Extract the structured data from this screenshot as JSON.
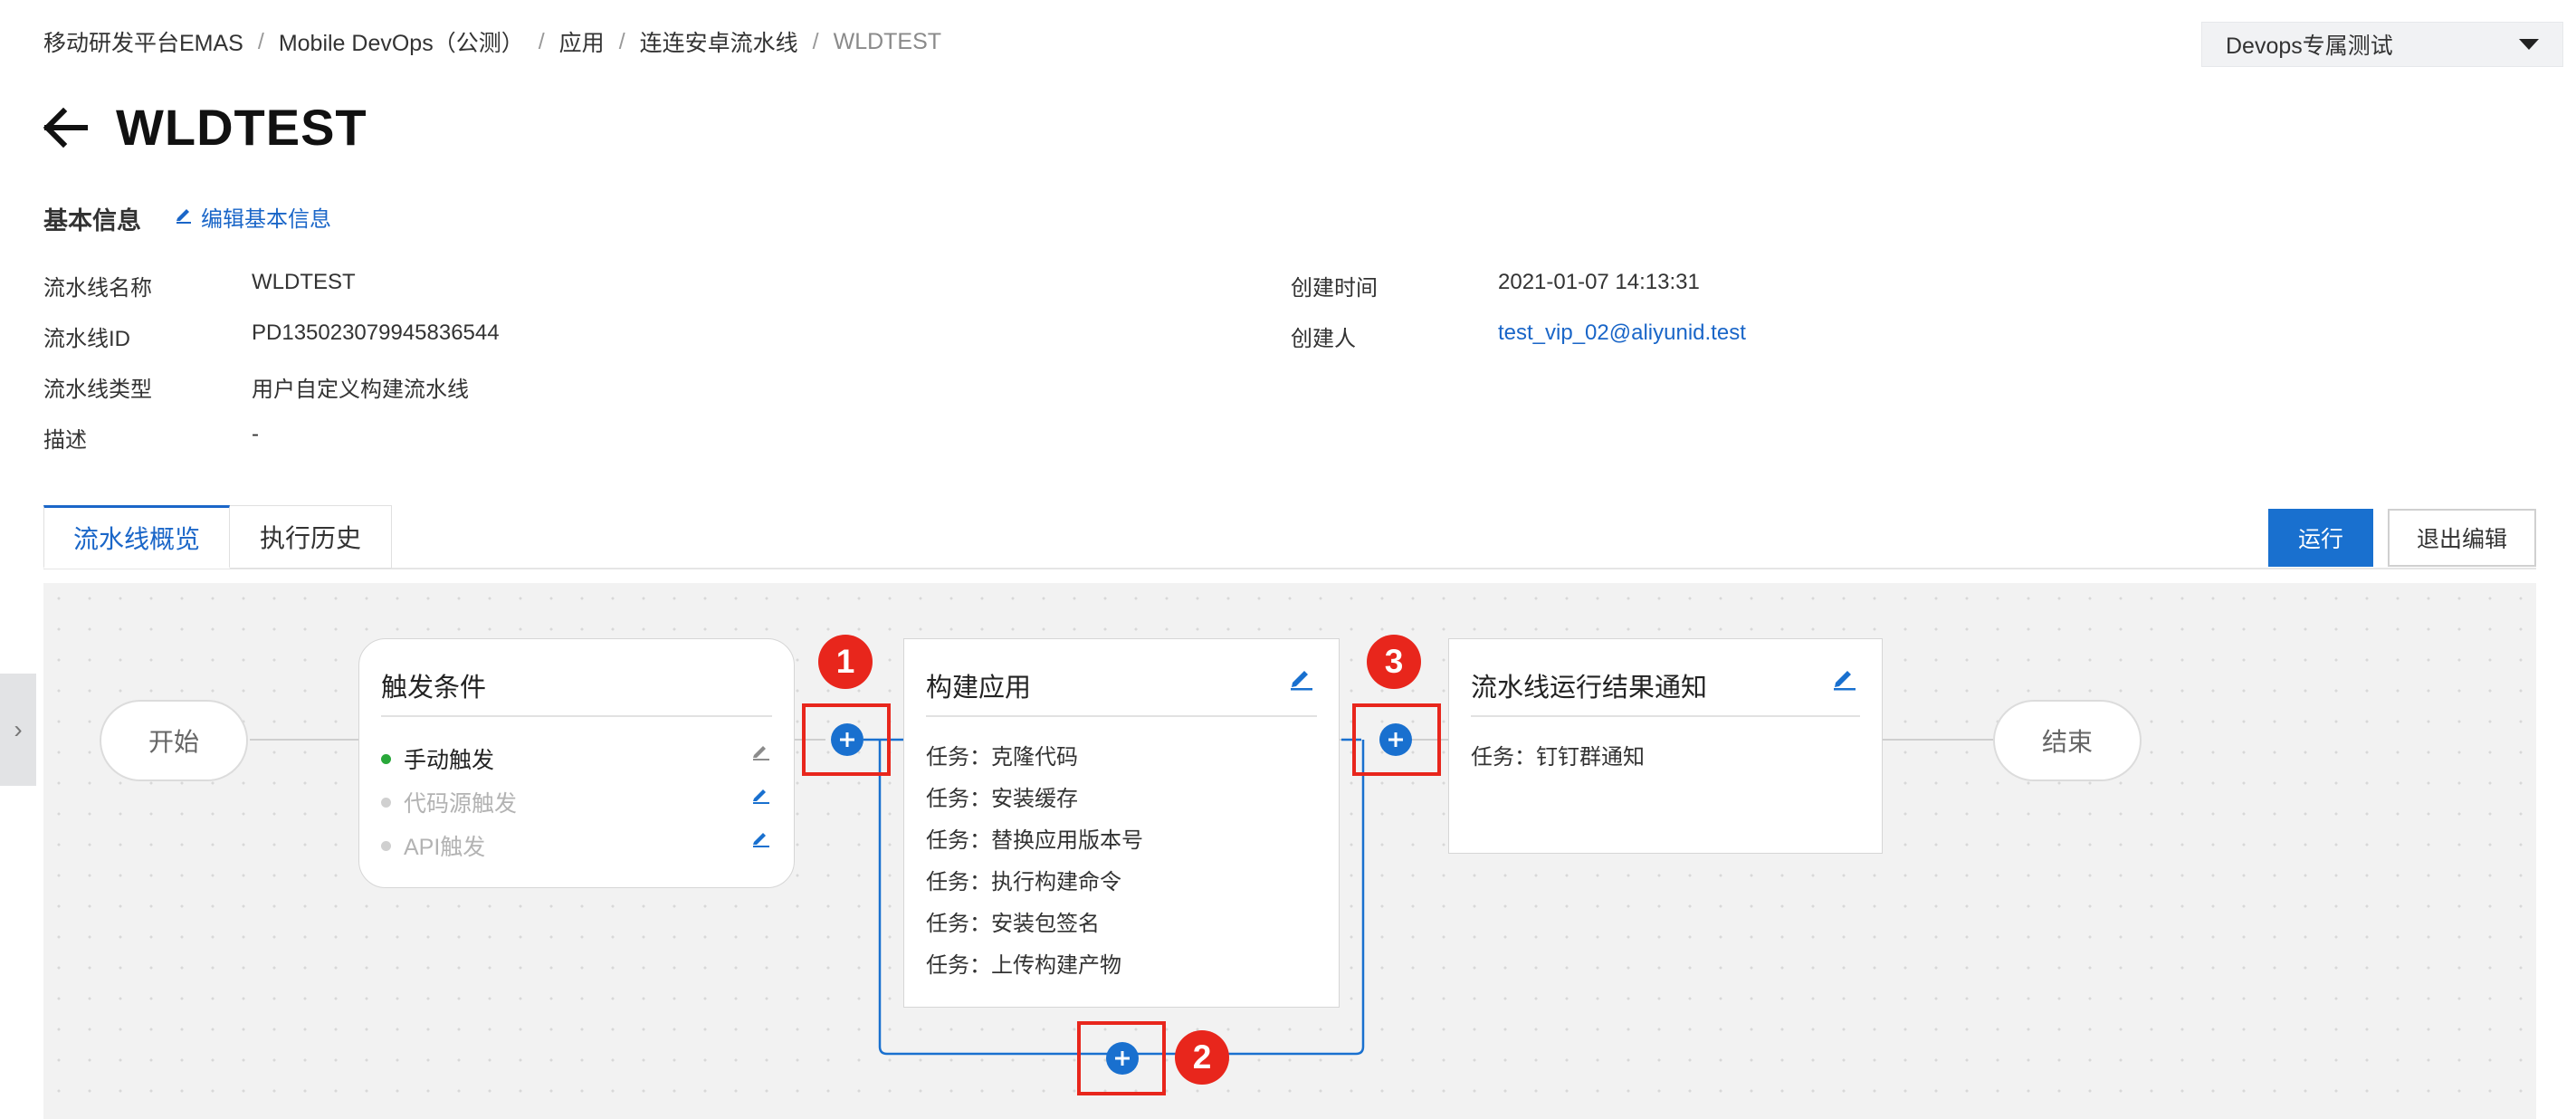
{
  "breadcrumb": [
    "移动研发平台EMAS",
    "Mobile DevOps（公测）",
    "应用",
    "连连安卓流水线",
    "WLDTEST"
  ],
  "project_selector": {
    "value": "Devops专属测试"
  },
  "page_title": "WLDTEST",
  "basic_info": {
    "section_title": "基本信息",
    "edit_label": "编辑基本信息",
    "fields": {
      "name_label": "流水线名称",
      "name_value": "WLDTEST",
      "id_label": "流水线ID",
      "id_value": "PD135023079945836544",
      "type_label": "流水线类型",
      "type_value": "用户自定义构建流水线",
      "desc_label": "描述",
      "desc_value": "-",
      "created_time_label": "创建时间",
      "created_time_value": "2021-01-07 14:13:31",
      "creator_label": "创建人",
      "creator_value": "test_vip_02@aliyunid.test"
    }
  },
  "tabs": [
    {
      "label": "流水线概览",
      "active": true
    },
    {
      "label": "执行历史",
      "active": false
    }
  ],
  "actions": {
    "run_label": "运行",
    "exit_label": "退出编辑"
  },
  "pipeline": {
    "start_label": "开始",
    "end_label": "结束",
    "trigger": {
      "title": "触发条件",
      "items": [
        {
          "label": "手动触发",
          "enabled": true
        },
        {
          "label": "代码源触发",
          "enabled": false
        },
        {
          "label": "API触发",
          "enabled": false
        }
      ]
    },
    "build": {
      "title": "构建应用",
      "tasks": [
        "任务：克隆代码",
        "任务：安装缓存",
        "任务：替换应用版本号",
        "任务：执行构建命令",
        "任务：安装包签名",
        "任务：上传构建产物"
      ]
    },
    "notify": {
      "title": "流水线运行结果通知",
      "tasks": [
        "任务：钉钉群通知"
      ]
    },
    "markers": [
      "1",
      "2",
      "3"
    ]
  },
  "colors": {
    "accent": "#1970cf",
    "link": "#1a66c8",
    "marker": "#e8261c",
    "enabled_dot": "#29a83a",
    "disabled_text": "#b3b3b3"
  }
}
